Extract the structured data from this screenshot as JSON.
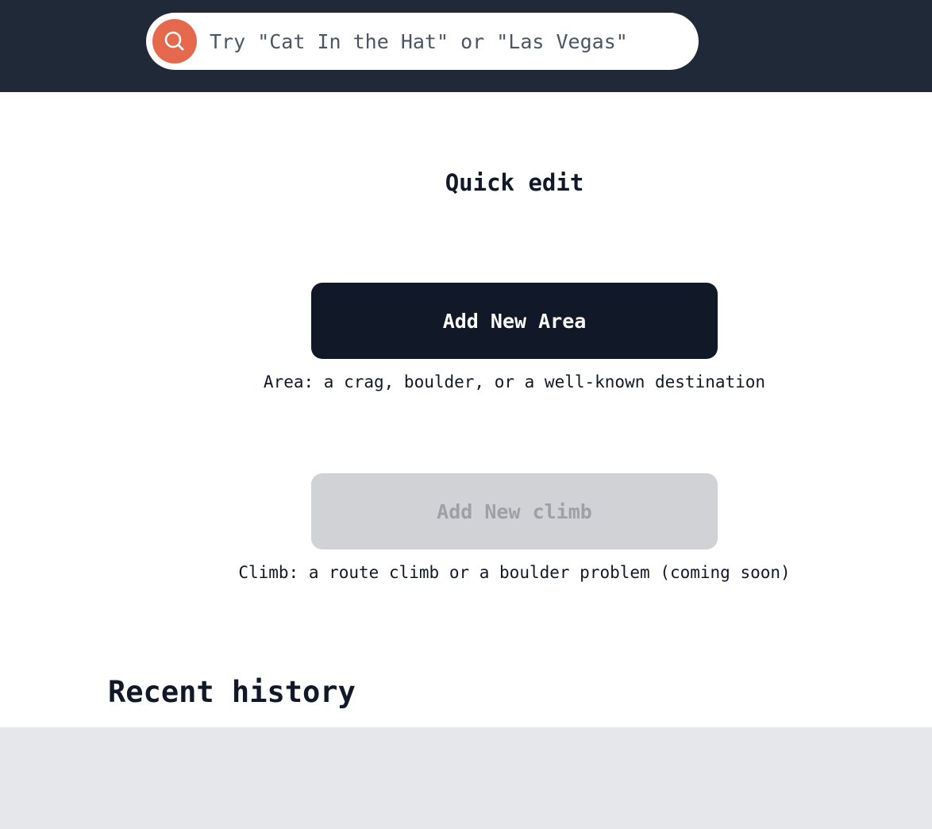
{
  "search": {
    "placeholder": "Try \"Cat In the Hat\" or \"Las Vegas\"",
    "value": "",
    "icon": "search-icon"
  },
  "quick_edit": {
    "title": "Quick edit",
    "add_area_label": "Add New Area",
    "add_area_caption": "Area: a crag, boulder, or a well-known destination",
    "add_climb_label": "Add New climb",
    "add_climb_caption": "Climb: a route climb or a boulder problem (coming soon)"
  },
  "recent": {
    "title": "Recent history"
  },
  "colors": {
    "header_bg": "#1f2937",
    "accent": "#e4694d",
    "primary_button": "#111827",
    "disabled_button": "#d1d2d6",
    "panel_bg": "#e5e7eb"
  }
}
